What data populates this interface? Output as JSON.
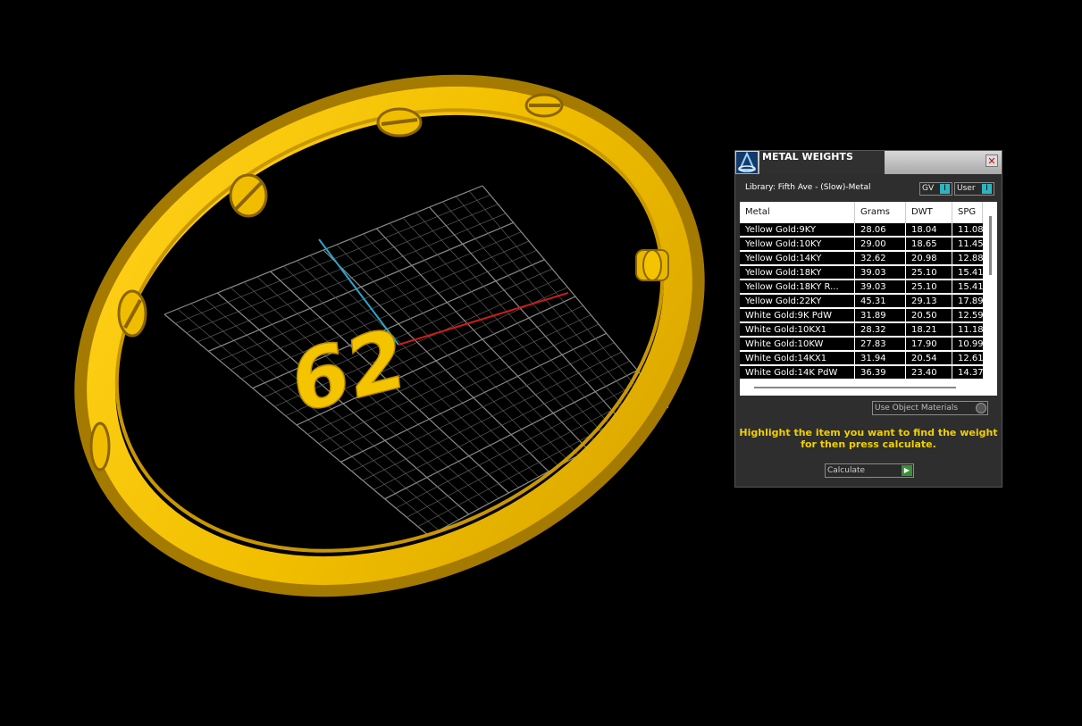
{
  "viewport": {
    "grid_label": "62",
    "colors": {
      "bangle": "#f5c400",
      "bangle_shadow": "#b88c00",
      "axis_x": "#d21a1a",
      "axis_y": "#2aa6c8",
      "grid": "#5a5a5a",
      "background": "#000000"
    }
  },
  "panel": {
    "title": "METAL WEIGHTS",
    "close_icon": "close-icon",
    "library_label": "Library: Fifth Ave - (Slow)-Metal",
    "toggles": {
      "gv": "GV",
      "user": "User",
      "knob": "I"
    },
    "table": {
      "columns": [
        "Metal",
        "Grams",
        "DWT",
        "SPG"
      ],
      "rows": [
        {
          "metal": "Yellow Gold:9KY",
          "grams": "28.06",
          "dwt": "18.04",
          "spg": "11.08"
        },
        {
          "metal": "Yellow Gold:10KY",
          "grams": "29.00",
          "dwt": "18.65",
          "spg": "11.45"
        },
        {
          "metal": "Yellow Gold:14KY",
          "grams": "32.62",
          "dwt": "20.98",
          "spg": "12.88"
        },
        {
          "metal": "Yellow Gold:18KY",
          "grams": "39.03",
          "dwt": "25.10",
          "spg": "15.41"
        },
        {
          "metal": "Yellow Gold:18KY R...",
          "grams": "39.03",
          "dwt": "25.10",
          "spg": "15.41"
        },
        {
          "metal": "Yellow Gold:22KY",
          "grams": "45.31",
          "dwt": "29.13",
          "spg": "17.89"
        },
        {
          "metal": "White Gold:9K PdW",
          "grams": "31.89",
          "dwt": "20.50",
          "spg": "12.59"
        },
        {
          "metal": "White Gold:10KX1",
          "grams": "28.32",
          "dwt": "18.21",
          "spg": "11.18"
        },
        {
          "metal": "White Gold:10KW",
          "grams": "27.83",
          "dwt": "17.90",
          "spg": "10.99"
        },
        {
          "metal": "White Gold:14KX1",
          "grams": "31.94",
          "dwt": "20.54",
          "spg": "12.61"
        },
        {
          "metal": "White Gold:14K PdW",
          "grams": "36.39",
          "dwt": "23.40",
          "spg": "14.37"
        }
      ]
    },
    "use_object_materials": "Use Object Materials",
    "hint": "Highlight the item you want to find the weight for then press calculate.",
    "calculate_label": "Calculate",
    "calculate_icon": "play-arrow-icon"
  }
}
